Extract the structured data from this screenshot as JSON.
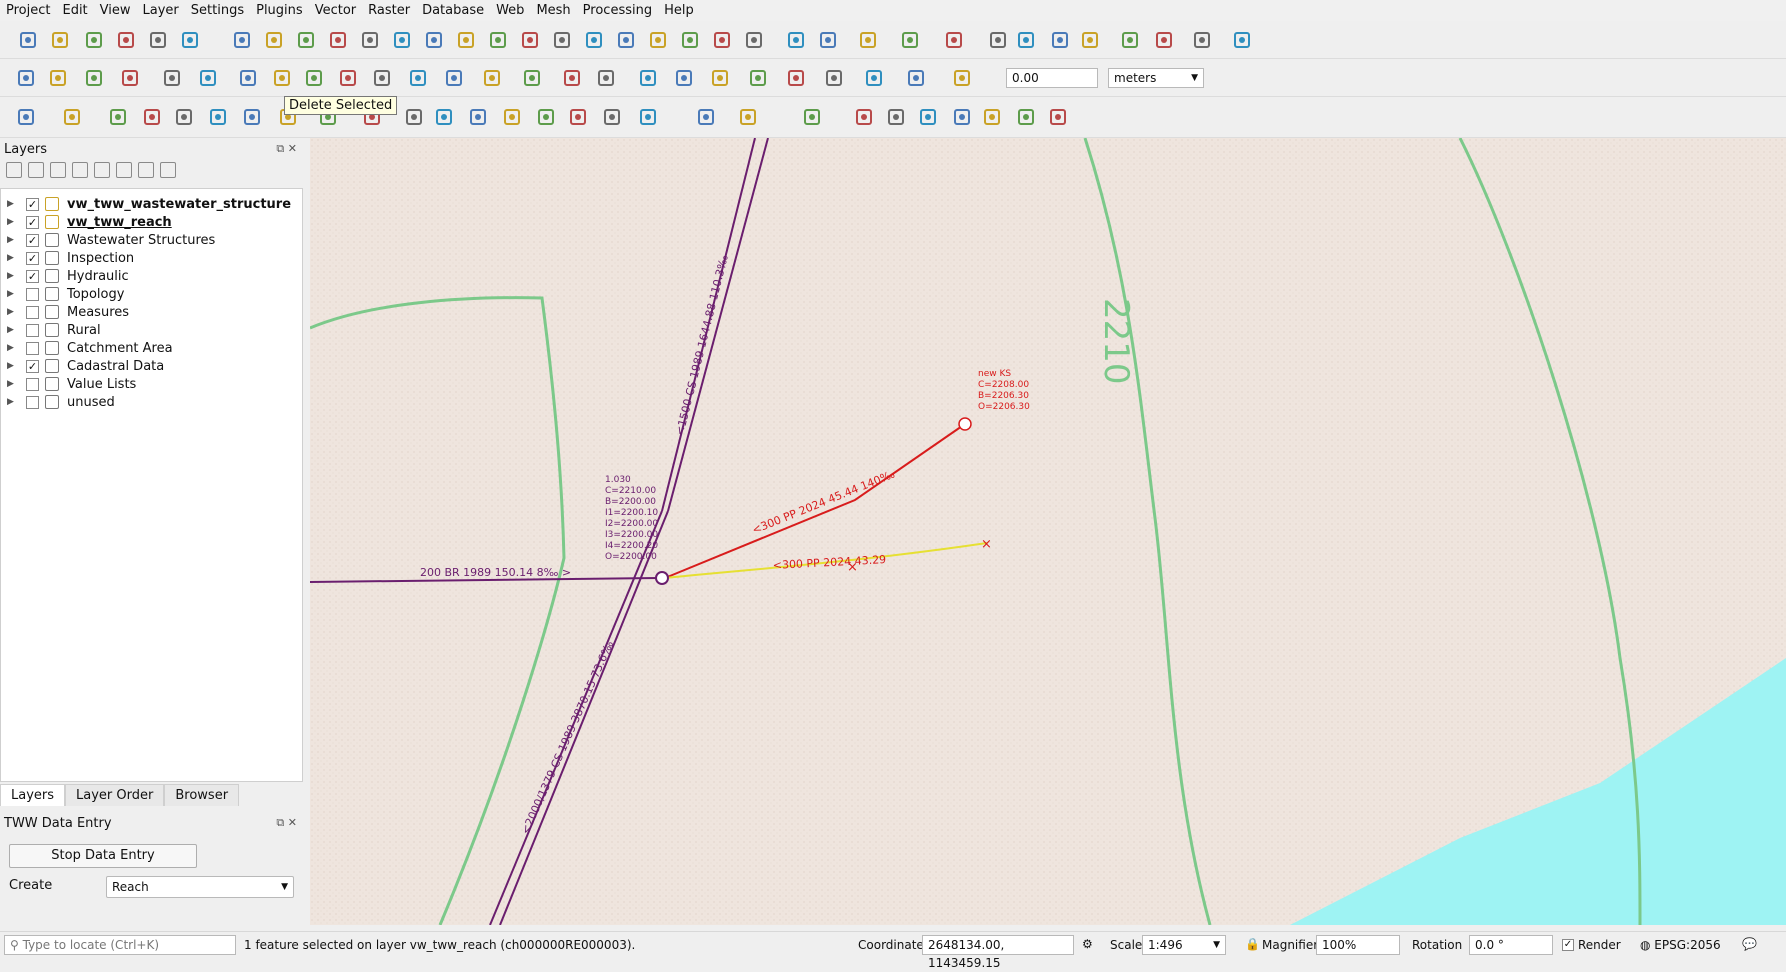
{
  "menu": [
    "Project",
    "Edit",
    "View",
    "Layer",
    "Settings",
    "Plugins",
    "Vector",
    "Raster",
    "Database",
    "Web",
    "Mesh",
    "Processing",
    "Help"
  ],
  "toolbar": {
    "tooltip": "Delete Selected",
    "distance_value": "0.00",
    "distance_unit": "meters"
  },
  "layers_panel": {
    "title": "Layers",
    "items": [
      {
        "label": "vw_tww_wastewater_structure",
        "checked": true,
        "bold": true,
        "underline": false,
        "icon": "pencil-icon"
      },
      {
        "label": "vw_tww_reach",
        "checked": true,
        "bold": true,
        "underline": true,
        "icon": "pencil-icon"
      },
      {
        "label": "Wastewater Structures",
        "checked": true,
        "bold": false,
        "icon": "group-icon"
      },
      {
        "label": "Inspection",
        "checked": true,
        "bold": false,
        "icon": "group-icon"
      },
      {
        "label": "Hydraulic",
        "checked": true,
        "bold": false,
        "icon": "group-icon"
      },
      {
        "label": "Topology",
        "checked": false,
        "bold": false,
        "icon": "group-icon"
      },
      {
        "label": "Measures",
        "checked": false,
        "bold": false,
        "icon": "group-icon"
      },
      {
        "label": "Rural",
        "checked": false,
        "bold": false,
        "icon": "group-icon"
      },
      {
        "label": "Catchment Area",
        "checked": false,
        "bold": false,
        "icon": "group-icon"
      },
      {
        "label": "Cadastral Data",
        "checked": true,
        "bold": false,
        "icon": "group-icon"
      },
      {
        "label": "Value Lists",
        "checked": false,
        "bold": false,
        "icon": "group-icon"
      },
      {
        "label": "unused",
        "checked": false,
        "bold": false,
        "icon": "group-icon"
      }
    ],
    "tabs": [
      "Layers",
      "Layer Order",
      "Browser"
    ]
  },
  "data_entry": {
    "title": "TWW Data Entry",
    "stop_button": "Stop Data Entry",
    "create_label": "Create",
    "create_value": "Reach"
  },
  "map": {
    "contour_label": "2210",
    "node_label": [
      "1.030",
      "C=2210.00",
      "B=2200.00",
      "I1=2200.10",
      "I2=2200.00",
      "I3=2200.00",
      "I4=2200.20",
      "O=2200.00"
    ],
    "new_ks_label": [
      "new KS",
      "C=2208.00",
      "B=2206.30",
      "O=2206.30"
    ],
    "reach_labels": {
      "north": "<1500 CS 1989 1644.88 110.3‰",
      "south": "<2000/1379 CS 1989 3870.15 73.6‰",
      "west": "200 BR 1989 150.14 8‰  >",
      "red": "<300 PP 2024 45.44 140‰",
      "yellow": "<300 PP 2024 43.29"
    },
    "colors": {
      "pipe": "#6a1e6e",
      "new_reach": "#d81c1c",
      "selected": "#e6e033",
      "contour": "#7cc98a",
      "water": "#9ef3f3",
      "map_bg": "#efe5de"
    }
  },
  "status": {
    "locate_placeholder": "Type to locate (Ctrl+K)",
    "message": "1 feature selected on layer vw_tww_reach (ch000000RE000003).",
    "coordinate_label": "Coordinate",
    "coordinate_value": "2648134.00, 1143459.15",
    "scale_label": "Scale",
    "scale_value": "1:496",
    "magnifier_label": "Magnifier",
    "magnifier_value": "100%",
    "rotation_label": "Rotation",
    "rotation_value": "0.0 °",
    "render_label": "Render",
    "crs": "EPSG:2056"
  }
}
